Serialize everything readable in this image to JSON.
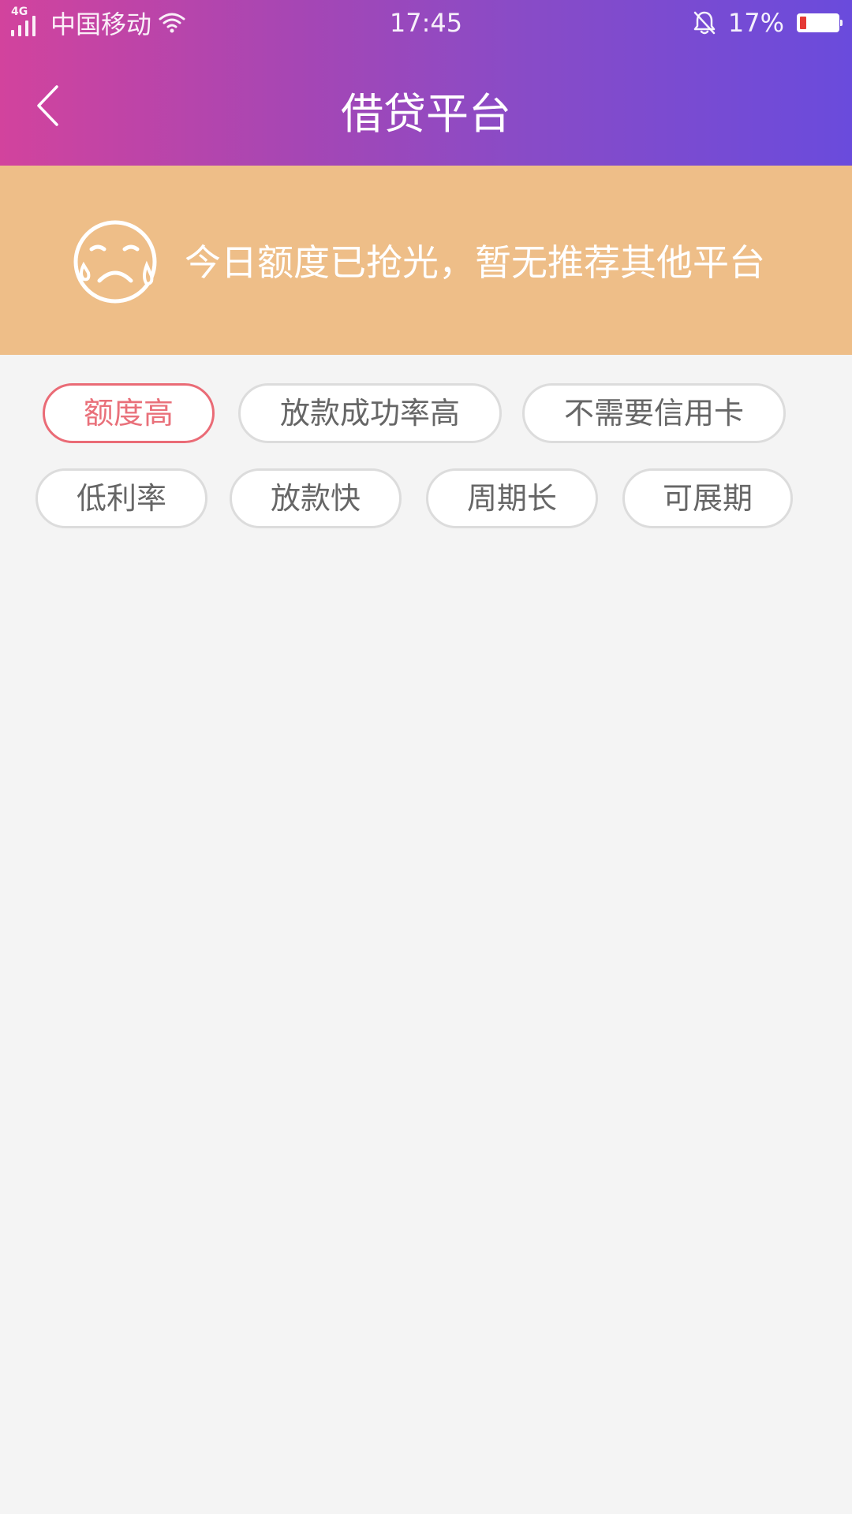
{
  "status_bar": {
    "network": "4G",
    "carrier": "中国移动",
    "time": "17:45",
    "battery_percent_label": "17%",
    "battery_level": 0.17,
    "battery_color": "#e53935"
  },
  "header": {
    "title": "借贷平台",
    "back_icon": "chevron-left-icon",
    "gradient_colors": [
      "#d2439d",
      "#6a4bdc"
    ]
  },
  "notice": {
    "icon": "sad-face-icon",
    "text": "今日额度已抢光，暂无推荐其他平台",
    "background": "#eebe88"
  },
  "tags": [
    {
      "label": "额度高",
      "active": true
    },
    {
      "label": "放款成功率高",
      "active": false
    },
    {
      "label": "不需要信用卡",
      "active": false
    },
    {
      "label": "低利率",
      "active": false
    },
    {
      "label": "放款快",
      "active": false
    },
    {
      "label": "周期长",
      "active": false
    },
    {
      "label": "可展期",
      "active": false
    }
  ],
  "colors": {
    "active_tag": "#ea6b76",
    "tag_border": "#dcdcdc",
    "page_background": "#f4f4f4"
  }
}
